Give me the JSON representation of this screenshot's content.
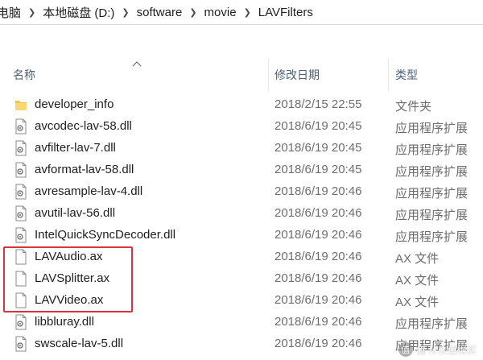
{
  "address_bar": {
    "crumbs": [
      "电脑",
      "本地磁盘 (D:)",
      "software",
      "movie",
      "LAVFilters"
    ]
  },
  "columns": {
    "name": "名称",
    "date_modified": "修改日期",
    "type": "类型"
  },
  "files": [
    {
      "name": "developer_info",
      "date": "2018/2/15 22:55",
      "type": "文件夹",
      "icon": "folder-icon"
    },
    {
      "name": "avcodec-lav-58.dll",
      "date": "2018/6/19 20:45",
      "type": "应用程序扩展",
      "icon": "dll-file-icon"
    },
    {
      "name": "avfilter-lav-7.dll",
      "date": "2018/6/19 20:45",
      "type": "应用程序扩展",
      "icon": "dll-file-icon"
    },
    {
      "name": "avformat-lav-58.dll",
      "date": "2018/6/19 20:45",
      "type": "应用程序扩展",
      "icon": "dll-file-icon"
    },
    {
      "name": "avresample-lav-4.dll",
      "date": "2018/6/19 20:46",
      "type": "应用程序扩展",
      "icon": "dll-file-icon"
    },
    {
      "name": "avutil-lav-56.dll",
      "date": "2018/6/19 20:46",
      "type": "应用程序扩展",
      "icon": "dll-file-icon"
    },
    {
      "name": "IntelQuickSyncDecoder.dll",
      "date": "2018/6/19 20:46",
      "type": "应用程序扩展",
      "icon": "dll-file-icon"
    },
    {
      "name": "LAVAudio.ax",
      "date": "2018/6/19 20:46",
      "type": "AX 文件",
      "icon": "blank-file-icon"
    },
    {
      "name": "LAVSplitter.ax",
      "date": "2018/6/19 20:46",
      "type": "AX 文件",
      "icon": "blank-file-icon"
    },
    {
      "name": "LAVVideo.ax",
      "date": "2018/6/19 20:46",
      "type": "AX 文件",
      "icon": "blank-file-icon"
    },
    {
      "name": "libbluray.dll",
      "date": "2018/6/19 20:46",
      "type": "应用程序扩展",
      "icon": "dll-file-icon"
    },
    {
      "name": "swscale-lav-5.dll",
      "date": "2018/6/19 20:46",
      "type": "应用程序扩展",
      "icon": "dll-file-icon"
    }
  ],
  "highlight": {
    "color": "#d6343a",
    "rows": [
      "LAVAudio.ax",
      "LAVSplitter.ax",
      "LAVVideo.ax"
    ]
  },
  "watermark": {
    "text": "值 什么值得买",
    "badge": "值"
  }
}
